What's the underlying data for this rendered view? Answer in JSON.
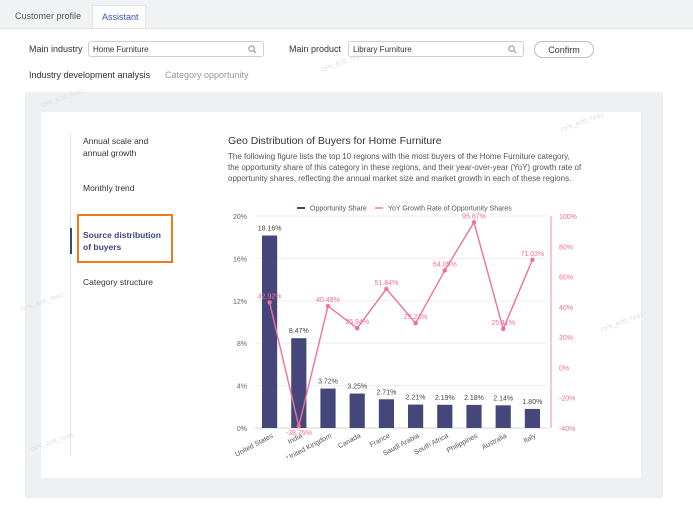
{
  "tabs": [
    {
      "label": "Customer profile"
    },
    {
      "label": "Assistant"
    }
  ],
  "filters": {
    "main_industry_label": "Main industry",
    "main_industry_value": "Home Furniture",
    "main_product_label": "Main product",
    "main_product_value": "Library Furniture",
    "confirm_label": "Confirm"
  },
  "subtabs": [
    {
      "label": "Industry development analysis"
    },
    {
      "label": "Category opportunity"
    }
  ],
  "sidebar": {
    "items": [
      {
        "label": "Annual scale and annual growth"
      },
      {
        "label": "Monthly trend"
      },
      {
        "label": "Source distribution of buyers"
      },
      {
        "label": "Category structure"
      }
    ]
  },
  "section": {
    "title": "Geo Distribution of Buyers for Home Furniture",
    "description": "The following figure lists the top 10 regions with the most buyers of the Home Furniture category, the opportunity share of this category in these regions, and their year-over-year (YoY) growth rate of opportunity shares, reflecting the annual market size and market growth in each of these regions."
  },
  "colors": {
    "bar": "#45477a",
    "line": "#f0709a",
    "highlight": "#f07a1a",
    "accent": "#3d4fb5"
  },
  "chart_data": {
    "type": "bar",
    "categories": [
      "United States",
      "India",
      "United Kingdom",
      "Canada",
      "France",
      "Saudi Arabia",
      "South Africa",
      "Philippines",
      "Australia",
      "Italy"
    ],
    "series": [
      {
        "name": "Opportunity Share",
        "type": "bar",
        "axis": "left",
        "values": [
          18.16,
          8.47,
          3.72,
          3.25,
          2.71,
          2.21,
          2.19,
          2.18,
          2.14,
          1.8
        ],
        "labels": [
          "18.16%",
          "8.47%",
          "3.72%",
          "3.25%",
          "2.71%",
          "2.21%",
          "2.19%",
          "2.18%",
          "2.14%",
          "1.80%"
        ]
      },
      {
        "name": "YoY Growth Rate of Opportunity Shares",
        "type": "line",
        "axis": "right",
        "values": [
          42.92,
          -38.75,
          40.49,
          25.94,
          51.84,
          29.23,
          64.05,
          95.87,
          25.41,
          71.03
        ],
        "labels": [
          "42.92%",
          "-38.75%",
          "40.49%",
          "25.94%",
          "51.84%",
          "29.23%",
          "64.05%",
          "95.87%",
          "25.41%",
          "71.03%"
        ]
      }
    ],
    "y_left": {
      "min": 0,
      "max": 20,
      "ticks": [
        "0%",
        "4%",
        "8%",
        "12%",
        "16%",
        "20%"
      ]
    },
    "y_right": {
      "min": -40,
      "max": 100,
      "ticks": [
        "-40%",
        "-20%",
        "0%",
        "20%",
        "40%",
        "60%",
        "80%",
        "100%"
      ]
    },
    "legend_position": "top",
    "grid": true
  }
}
